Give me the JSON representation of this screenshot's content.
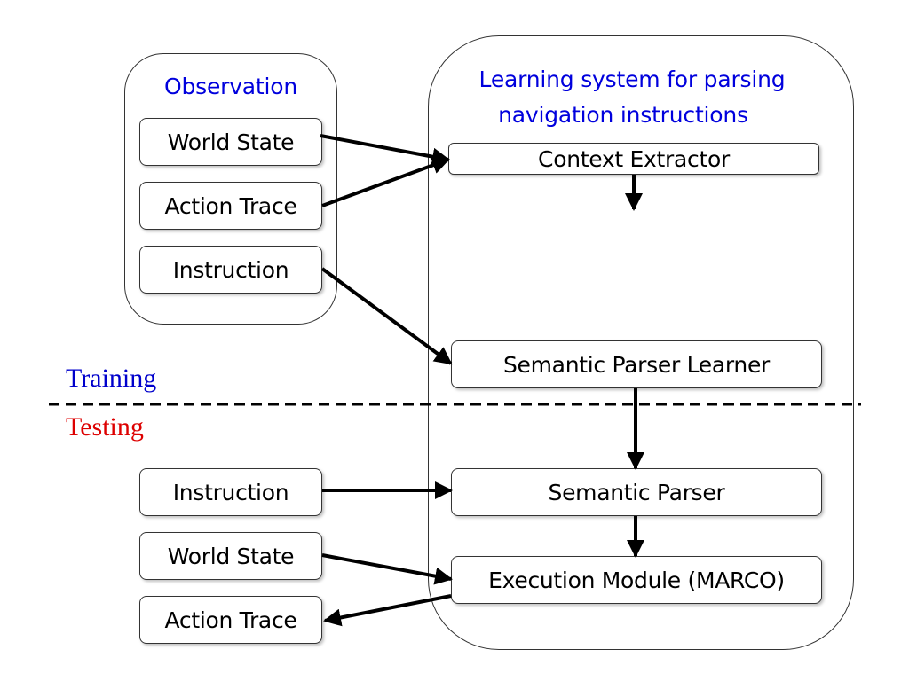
{
  "observation": {
    "title": "Observation",
    "items": [
      "World State",
      "Action Trace",
      "Instruction"
    ]
  },
  "system": {
    "title_line1": "Learning system for parsing",
    "title_line2": "navigation instructions",
    "context_extractor": "Context Extractor",
    "semantic_parser_learner": "Semantic Parser Learner",
    "semantic_parser": "Semantic Parser",
    "execution_module": "Execution Module (MARCO)"
  },
  "phases": {
    "training": "Training",
    "testing": "Testing",
    "training_color": "#0000cc",
    "testing_color": "#dd0000"
  },
  "testing_inputs": {
    "instruction": "Instruction",
    "world_state": "World State",
    "action_trace": "Action Trace"
  }
}
